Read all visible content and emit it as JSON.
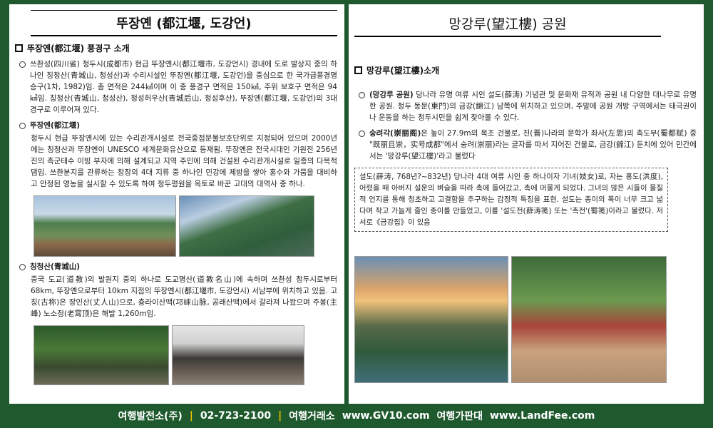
{
  "left": {
    "title": "뚜장옌 (都江堰, 도강언)",
    "section_head": "뚜장옌(都江堰) 풍경구 소개",
    "item1": "쓰촨성(四川省) 청두시(成都市) 현급 뚜장옌시(都江堰市, 도강언시) 경내에 도로 발상지 중의 하나인 칭청산(青城山, 청성산)과 수리시설인 뚜장옌(都江堰, 도강언)을 중심으로 한 국가급풍경명승구(1차, 1982)임. 총 면적은 244㎢이며 이 중 풍경구 면적은 150㎢, 주위 보호구 면적은 94㎢임. 칭청산(青城山, 청성산), 청성허우산(青城后山, 청성후산), 뚜장옌(都江堰, 도강언)의 3대 경구로 이루어져 있다.",
    "item2_head": "뚜장옌(都江堰)",
    "item2_body": "청두시 현급 뚜장옌시에 있는 수리관개시설로 전국중점문물보호단위로 지정되어 있으며 2000년에는 칭청산과 뚜장옌이 UNESCO 세계문화유산으로 등재됨. 뚜장옌은 전국시대인 기원전 256년 진의 촉군태수 이빙 부자에 의해 설계되고 지역 주민에 의해 건설된 수리관개시설로 일종의 다목적 댐임. 쓰촨분지를 관류하는 창장의 4대 지류 중 하나인 민강에 제방을 쌓아 홍수와 가뭄을 대비하고 안정된 영농을 실시할 수 있도록 하여 청두평원을 옥토로 바꾼 고대의 대역사 중 하나.",
    "item3_head": "칭청산(青城山)",
    "item3_body": "중국 도교(道教)의 발원지 중의 하나로 도교명산(道教名山)에 속하며 쓰촨성 청두시로부터 68km, 뚜장옌으로부터 10km 지점의 뚜장옌시(都江堰市, 도강언시) 서남부에 위치하고 있음. 고칭(古称)은 장인산(丈人山)으로, 츙라이산맥(邛崃山脉, 공래산맥)에서 갈라져 나왔으며 주봉(主峰) 노소정(老霄顶)은 해발 1,260m임."
  },
  "right": {
    "title": "망강루(望江樓) 공원",
    "section_head": "망강루(望江樓)소개",
    "item1_head": "(망강루 공원)",
    "item1_body": " 당나라 유명 여류 시인 설도(薛涛) 기념관 및 문화재 유적과 공원 내 다양한 대나무로 유명한 공원. 청두 동문(東門)의 금강(錦江) 남쪽에 위치하고 있으며, 주말에 공원 개방 구역에서는 태극권이나 운동을 하는 청두시민을 쉽게 찾아볼 수 있다.",
    "item2_head": "숭려각(崇丽阁)",
    "item2_body": "은 높이 27.9m의 목조 건물로, 진(晋)나라의 문학가 좌사(左思)의 촉도부(蜀都赋) 중 \"既丽且崇，实号成都\"에서 숭려(崇丽)라는 글자를 따서 지어진 건물로, 금강(錦江) 둔치에 있어 민간에서는 '망강루(望江樓)'라고 불렀다",
    "note": "설도(薛涛, 768년?~832년) 당나라 4대 여류 시인 중 하나이자 기녀(妓女)로, 자는 홍도(洪度), 어렸을 때 아버지 설운의 벼슬을 따라 촉에 들어갔고, 촉에 머물게 되었다. 그녀의 많은 시들이 물질적 언지를 통해 청초하고 고결함을 추구하는 감정적 특징을 표현. 설도는 종이의 폭이 너무 크고 넓다며 작고 가늘게 줄인 종이를 만들었고, 이를 '설도전(薛涛笺) 또는 '촉전'(蜀笺)이라고 불렀다. 저서로《금강집》이 있음"
  },
  "footer": {
    "company": "여행발전소(주)",
    "phone": "02-723-2100",
    "exchange": "여행거래소",
    "site1": "www.GV10.com",
    "board": "여행가판대",
    "site2": "www.LandFee.com",
    "separator": "|"
  }
}
